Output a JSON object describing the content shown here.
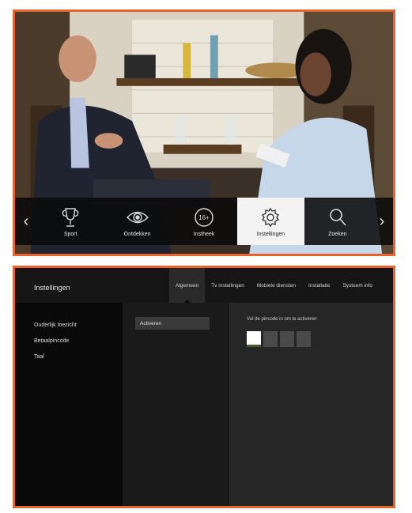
{
  "top_screen": {
    "nav": {
      "left_arrow": "‹",
      "right_arrow": "›"
    },
    "menu": [
      {
        "label": "Sport",
        "icon": "trophy-icon",
        "active": false
      },
      {
        "label": "Ontdekken",
        "icon": "eye-icon",
        "active": false
      },
      {
        "label": "Instheek",
        "icon": "rating-16-icon",
        "badge": "16+",
        "active": false
      },
      {
        "label": "Instellingen",
        "icon": "gear-icon",
        "active": true
      },
      {
        "label": "Zoeken",
        "icon": "search-icon",
        "active": false
      }
    ]
  },
  "bottom_screen": {
    "title": "Instellingen",
    "tabs": [
      {
        "label": "Algemeen",
        "active": true
      },
      {
        "label": "Tv instellingen",
        "active": false
      },
      {
        "label": "Mobiele diensten",
        "active": false
      },
      {
        "label": "Installatie",
        "active": false
      },
      {
        "label": "Systeem info",
        "active": false
      }
    ],
    "left_items": [
      "Ouderlijk toezicht",
      "Betaalpincode",
      "Taal"
    ],
    "mid_button": "Activeren",
    "pin_prompt": "Vul de pincode in om te activeren",
    "pin": {
      "filled": 1,
      "total": 4
    }
  },
  "colors": {
    "frame": "#e8642a",
    "menu_bg": "#0a0a0a",
    "active_tab": "#2a2a2a"
  }
}
